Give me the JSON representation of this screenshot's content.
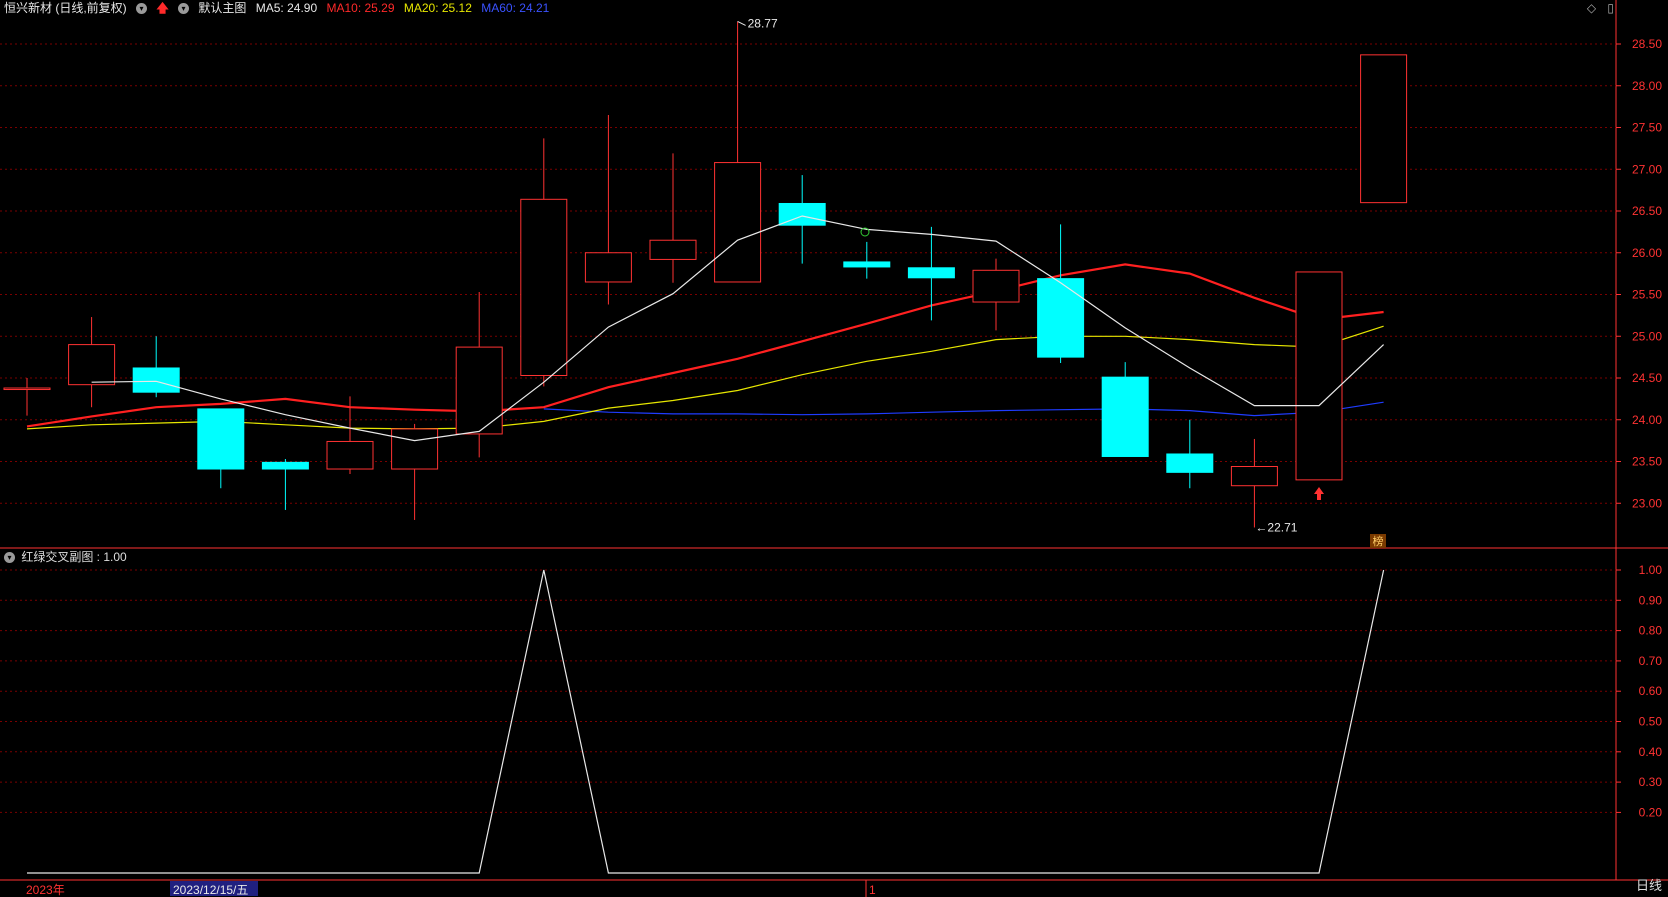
{
  "header": {
    "stock_title": "恒兴新材 (日线,前复权)",
    "main_chart_label": "默认主图",
    "ma5": "MA5: 24.90",
    "ma10": "MA10: 25.29",
    "ma20": "MA20: 25.12",
    "ma60": "MA60: 24.21"
  },
  "sub_header": {
    "indicator_label": "红绿交叉副图 : 1.00"
  },
  "footer": {
    "year_label": "2023年",
    "cursor_date": "2023/12/15/五",
    "month_marker": "1",
    "period": "日线"
  },
  "toolbar": {
    "icons": [
      "diamond-icon",
      "scrollbar-icon"
    ]
  },
  "colors": {
    "up": "#ff3232",
    "down": "#00ffff",
    "ma5": "#e8e8e8",
    "ma10": "#ff2020",
    "ma20": "#e6e600",
    "ma60": "#1f3cff",
    "grid": "#7a0000",
    "axis": "#ff3232"
  },
  "chart_data": [
    {
      "type": "candlestick",
      "title": "恒兴新材 (日线,前复权)",
      "ylim": [
        22.4,
        28.8
      ],
      "y_ticks": [
        "28.50",
        "28.00",
        "27.50",
        "27.00",
        "26.50",
        "26.00",
        "25.50",
        "25.00",
        "24.50",
        "24.00",
        "23.50",
        "23.00"
      ],
      "candles": [
        {
          "o": 24.38,
          "h": 24.5,
          "l": 24.05,
          "c": 24.38
        },
        {
          "o": 24.42,
          "h": 25.23,
          "l": 24.15,
          "c": 24.9
        },
        {
          "o": 24.62,
          "h": 25.0,
          "l": 24.27,
          "c": 24.33
        },
        {
          "o": 24.13,
          "h": 24.13,
          "l": 23.18,
          "c": 23.41
        },
        {
          "o": 23.49,
          "h": 23.53,
          "l": 22.92,
          "c": 23.41
        },
        {
          "o": 23.41,
          "h": 24.28,
          "l": 23.35,
          "c": 23.74
        },
        {
          "o": 23.41,
          "h": 23.95,
          "l": 22.8,
          "c": 23.89
        },
        {
          "o": 23.83,
          "h": 25.53,
          "l": 23.55,
          "c": 24.87
        },
        {
          "o": 24.53,
          "h": 27.37,
          "l": 24.4,
          "c": 26.64
        },
        {
          "o": 25.65,
          "h": 27.65,
          "l": 25.38,
          "c": 26.0
        },
        {
          "o": 25.92,
          "h": 27.19,
          "l": 25.64,
          "c": 26.15
        },
        {
          "o": 25.65,
          "h": 28.77,
          "l": 25.65,
          "c": 27.08
        },
        {
          "o": 26.59,
          "h": 26.93,
          "l": 25.87,
          "c": 26.33
        },
        {
          "o": 25.89,
          "h": 26.13,
          "l": 25.69,
          "c": 25.83
        },
        {
          "o": 25.82,
          "h": 26.31,
          "l": 25.19,
          "c": 25.7
        },
        {
          "o": 25.41,
          "h": 25.93,
          "l": 25.07,
          "c": 25.79
        },
        {
          "o": 25.69,
          "h": 26.34,
          "l": 24.68,
          "c": 24.75
        },
        {
          "o": 24.51,
          "h": 24.69,
          "l": 23.56,
          "c": 23.56
        },
        {
          "o": 23.59,
          "h": 24.0,
          "l": 23.18,
          "c": 23.37
        },
        {
          "o": 23.21,
          "h": 23.77,
          "l": 22.71,
          "c": 23.44
        },
        {
          "o": 23.28,
          "h": 25.77,
          "l": 23.28,
          "c": 25.77
        },
        {
          "o": 26.6,
          "h": 28.37,
          "l": 26.6,
          "c": 28.37
        }
      ],
      "ma5": [
        null,
        24.45,
        24.46,
        24.25,
        24.06,
        23.9,
        23.75,
        23.86,
        24.45,
        25.11,
        25.51,
        26.15,
        26.44,
        26.28,
        26.22,
        26.14,
        25.64,
        25.1,
        24.62,
        24.17,
        24.17,
        24.9
      ],
      "ma10": [
        23.92,
        24.04,
        24.15,
        24.19,
        24.25,
        24.15,
        24.12,
        24.1,
        24.15,
        24.39,
        24.56,
        24.73,
        24.94,
        25.15,
        25.37,
        25.54,
        25.73,
        25.86,
        25.75,
        25.46,
        25.2,
        25.29
      ],
      "ma20": [
        23.89,
        23.94,
        23.96,
        23.98,
        23.94,
        23.9,
        23.89,
        23.9,
        23.98,
        24.14,
        24.23,
        24.35,
        24.54,
        24.7,
        24.82,
        24.96,
        25.0,
        25.0,
        24.96,
        24.9,
        24.87,
        25.12
      ],
      "ma60": [
        null,
        null,
        null,
        null,
        null,
        null,
        null,
        null,
        24.13,
        24.09,
        24.07,
        24.07,
        24.06,
        24.07,
        24.09,
        24.11,
        24.12,
        24.13,
        24.11,
        24.05,
        24.09,
        24.21
      ],
      "annotations": [
        {
          "label": "28.77"
        },
        {
          "label": "←22.71"
        },
        {
          "label": "榜"
        }
      ]
    },
    {
      "type": "line",
      "title": "红绿交叉副图 : 1.00",
      "ylim": [
        0,
        1.02
      ],
      "y_ticks": [
        "1.00",
        "0.90",
        "0.80",
        "0.70",
        "0.60",
        "0.50",
        "0.40",
        "0.30",
        "0.20"
      ],
      "values": [
        0,
        0,
        0,
        0,
        0,
        0,
        0,
        0,
        1,
        0,
        0,
        0,
        0,
        0,
        0,
        0,
        0,
        0,
        0,
        0,
        0,
        1
      ]
    }
  ]
}
